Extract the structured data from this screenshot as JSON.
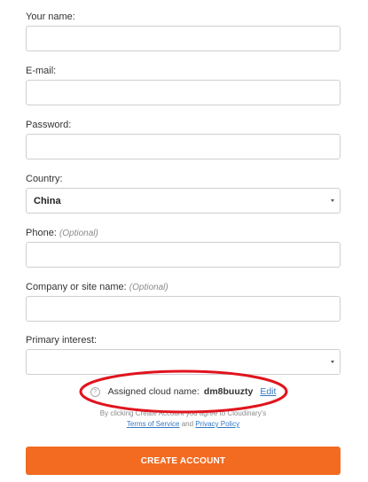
{
  "form": {
    "name": {
      "label": "Your name:",
      "value": ""
    },
    "email": {
      "label": "E-mail:",
      "value": ""
    },
    "password": {
      "label": "Password:",
      "value": ""
    },
    "country": {
      "label": "Country:",
      "value": "China"
    },
    "phone": {
      "label": "Phone:",
      "optional": "(Optional)",
      "value": ""
    },
    "company": {
      "label": "Company or site name:",
      "optional": "(Optional)",
      "value": ""
    },
    "interest": {
      "label": "Primary interest:",
      "value": ""
    }
  },
  "cloud": {
    "help_icon": "question-icon",
    "label": "Assigned cloud name:",
    "name": "dm8buuzty",
    "edit": "Edit"
  },
  "terms": {
    "prefix": "By clicking Create Account you agree to Cloudinary's",
    "tos": "Terms of Service",
    "and": "and",
    "privacy": "Privacy Policy"
  },
  "submit": {
    "label": "CREATE ACCOUNT"
  },
  "colors": {
    "accent": "#f26b21",
    "link": "#3478c6",
    "annotation": "#e0141e"
  }
}
